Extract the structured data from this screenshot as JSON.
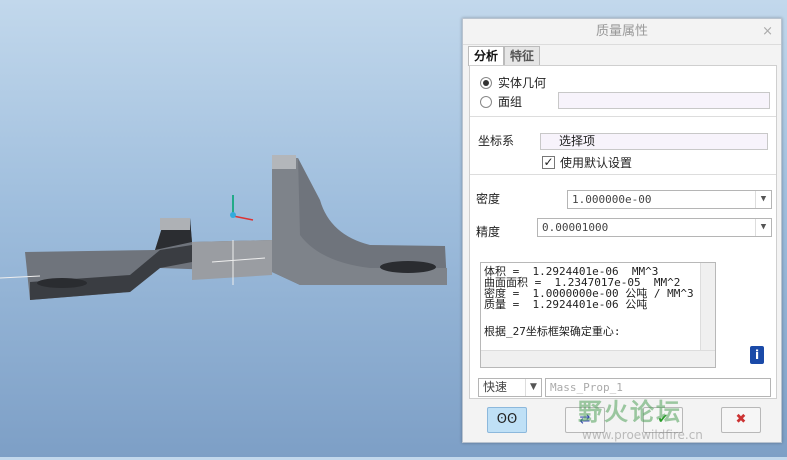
{
  "dialog": {
    "title": "质量属性",
    "close": "×"
  },
  "tabs": [
    "分析",
    "特征"
  ],
  "geometry": {
    "solid": "实体几何",
    "quilt": "面组",
    "selected": "solid"
  },
  "csys": {
    "label": "坐标系",
    "value": "选择项",
    "use_default": "使用默认设置",
    "use_default_checked": true
  },
  "density": {
    "label": "密度",
    "value": "1.000000e-00"
  },
  "accuracy": {
    "label": "精度",
    "value": "0.00001000"
  },
  "output": {
    "lines": [
      "体积 =  1.2924401e-06  MM^3",
      "曲面面积 =  1.2347017e-05  MM^2",
      "密度 =  1.0000000e-00 公吨 / MM^3",
      "质量 =  1.2924401e-06 公吨",
      "",
      "根据_27坐标框架确定重心:"
    ]
  },
  "mode": {
    "value": "快速"
  },
  "feature_name": {
    "value": "Mass_Prop_1"
  },
  "watermark": {
    "text": "野火论坛",
    "url": "www.proewildfire.cn"
  }
}
